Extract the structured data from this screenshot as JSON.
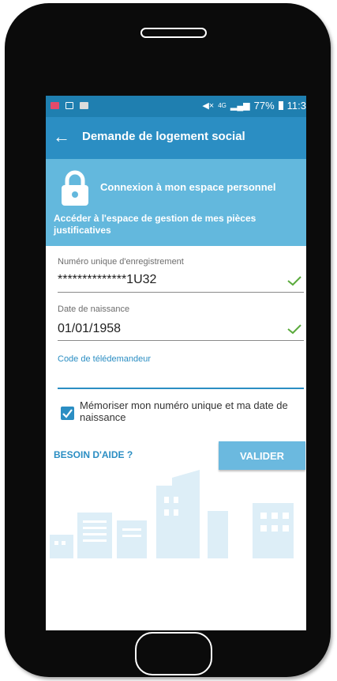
{
  "statusbar": {
    "signal_label": "4G",
    "battery": "77%",
    "time": "11:3"
  },
  "appbar": {
    "title": "Demande de logement social"
  },
  "hero": {
    "title": "Connexion à mon espace personnel",
    "subtitle": "Accéder à l'espace de gestion de mes pièces justificatives"
  },
  "form": {
    "id_label": "Numéro unique d'enregistrement",
    "id_value": "**************1U32",
    "birth_label": "Date de naissance",
    "birth_value": "01/01/1958",
    "code_label": "Code de télédemandeur",
    "code_value": "",
    "remember_label": "Mémoriser mon numéro unique et ma date de naissance",
    "remember_checked": true
  },
  "actions": {
    "help": "BESOIN D'AIDE ?",
    "submit": "VALIDER"
  },
  "colors": {
    "primary": "#2b8ec3",
    "hero": "#63b8dd",
    "check": "#5aaa3c"
  }
}
